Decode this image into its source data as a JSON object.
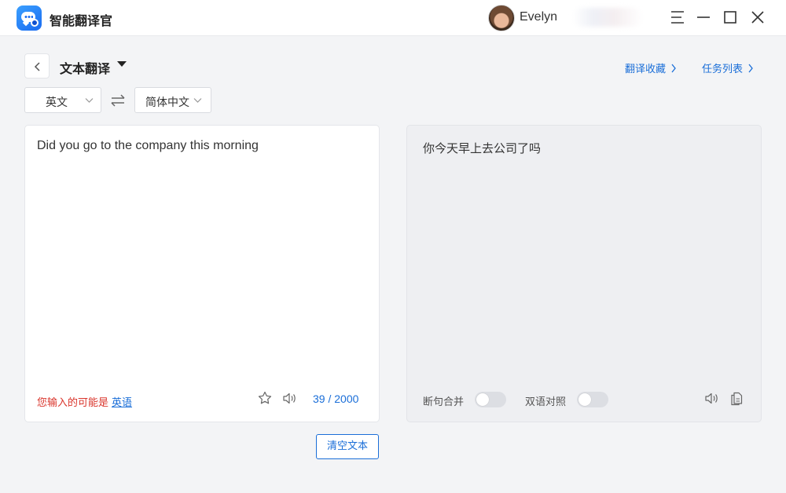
{
  "app": {
    "title": "智能翻译官",
    "accent": "#1a6ed8"
  },
  "user": {
    "name": "Evelyn"
  },
  "window_controls": [
    "menu-icon",
    "minimize-icon",
    "maximize-icon",
    "close-icon"
  ],
  "header": {
    "section_title": "文本翻译",
    "links": {
      "favorites": "翻译收藏",
      "tasks": "任务列表"
    }
  },
  "languages": {
    "source": "英文",
    "target": "简体中文"
  },
  "source": {
    "text": "Did you go to the company this morning",
    "detect_prefix": "您输入的可能是",
    "detect_lang": "英语",
    "char_count": "39 / 2000"
  },
  "target": {
    "text": "你今天早上去公司了吗",
    "toggles": [
      {
        "label": "断句合并",
        "on": false
      },
      {
        "label": "双语对照",
        "on": false
      }
    ]
  },
  "actions": {
    "clear": "清空文本"
  }
}
